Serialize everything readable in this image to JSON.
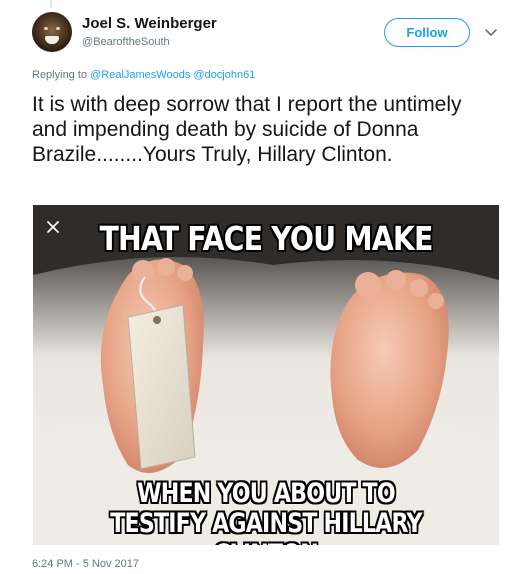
{
  "author": {
    "name": "Joel S. Weinberger",
    "handle": "@BearoftheSouth"
  },
  "follow_button": {
    "label": "Follow"
  },
  "reply": {
    "prefix": "Replying to",
    "mentions": [
      "@RealJamesWoods",
      "@docjohn61"
    ]
  },
  "tweet": {
    "text": "It is with deep sorrow that I report the untimely and impending death by suicide of Donna Brazile........Yours Truly, Hillary Clinton."
  },
  "media": {
    "caption_top": "THAT FACE YOU MAKE",
    "caption_bottom_line1": "WHEN YOU ABOUT TO",
    "caption_bottom_line2": "TESTIFY AGAINST HILLARY CLINTON"
  },
  "timestamp": "6:24 PM - 5 Nov 2017",
  "colors": {
    "accent": "#1da1f2",
    "muted": "#657786",
    "text": "#14171a"
  },
  "icons": {
    "caret": "chevron-down-icon",
    "close": "close-icon"
  }
}
